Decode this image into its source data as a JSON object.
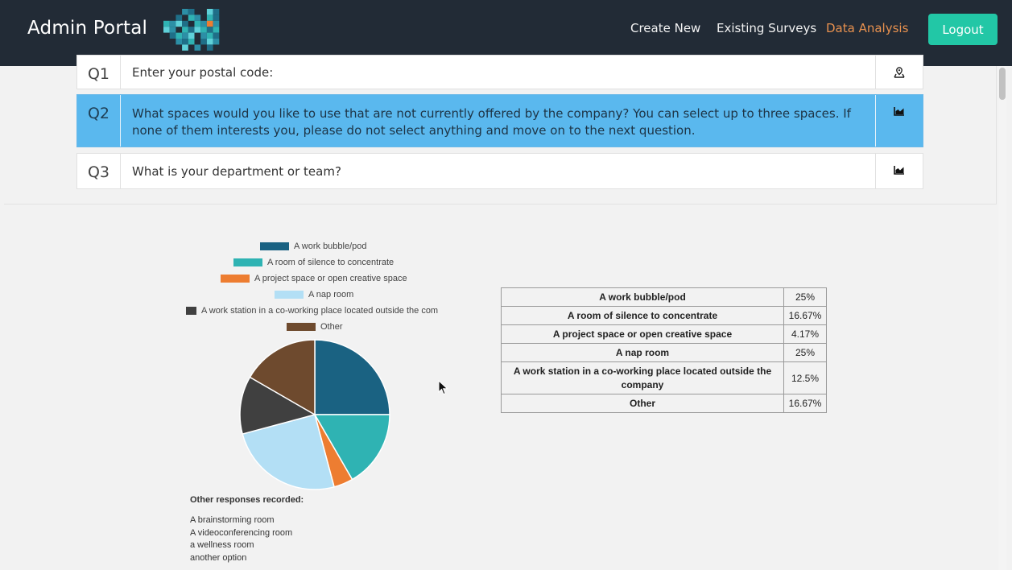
{
  "app": {
    "brand": "Admin Portal",
    "nav": [
      {
        "label": "Create New",
        "active": false
      },
      {
        "label": "Existing Surveys",
        "active": false
      },
      {
        "label": "Data Analysis",
        "active": true
      }
    ],
    "logout_label": "Logout",
    "accent_color": "#22c7a6",
    "active_nav_color": "#e8914f"
  },
  "questions": [
    {
      "number": "Q1",
      "text": "Enter your postal code:",
      "icon": "map-marker-icon",
      "selected": false
    },
    {
      "number": "Q2",
      "text": "What spaces would you like to use that are not currently offered by the company? You can select up to three spaces. If none of them interests you, please do not select anything and move on to the next question.",
      "icon": "area-chart-icon",
      "selected": true
    },
    {
      "number": "Q3",
      "text": "What is your department or team?",
      "icon": "area-chart-icon",
      "selected": false
    }
  ],
  "chart_data": {
    "type": "pie",
    "title": "",
    "legend_position": "top",
    "categories": [
      "A work bubble/pod",
      "A room of silence to concentrate",
      "A project space or open creative space",
      "A nap room",
      "A work station in a co-working place located outside the company",
      "Other"
    ],
    "legend_labels": [
      "A work bubble/pod",
      "A room of silence to concentrate",
      "A project space or open creative space",
      "A nap room",
      "A work station in a co-working place located outside the com",
      "Other"
    ],
    "values": [
      25,
      16.67,
      4.17,
      25,
      12.5,
      16.67
    ],
    "colors": [
      "#1a6282",
      "#2fb3b3",
      "#ed7d31",
      "#b3dff5",
      "#404040",
      "#6e4a2e"
    ]
  },
  "results_table": {
    "rows": [
      {
        "label": "A work bubble/pod",
        "percent": "25%"
      },
      {
        "label": "A room of silence to concentrate",
        "percent": "16.67%"
      },
      {
        "label": "A project space or open creative space",
        "percent": "4.17%"
      },
      {
        "label": "A nap room",
        "percent": "25%"
      },
      {
        "label": "A work station in a co-working place located outside the company",
        "percent": "12.5%"
      },
      {
        "label": "Other",
        "percent": "16.67%"
      }
    ]
  },
  "other_responses": {
    "title": "Other responses recorded:",
    "items": [
      "A brainstorming room",
      "A videoconferencing room",
      "a wellness room",
      "another option"
    ]
  }
}
